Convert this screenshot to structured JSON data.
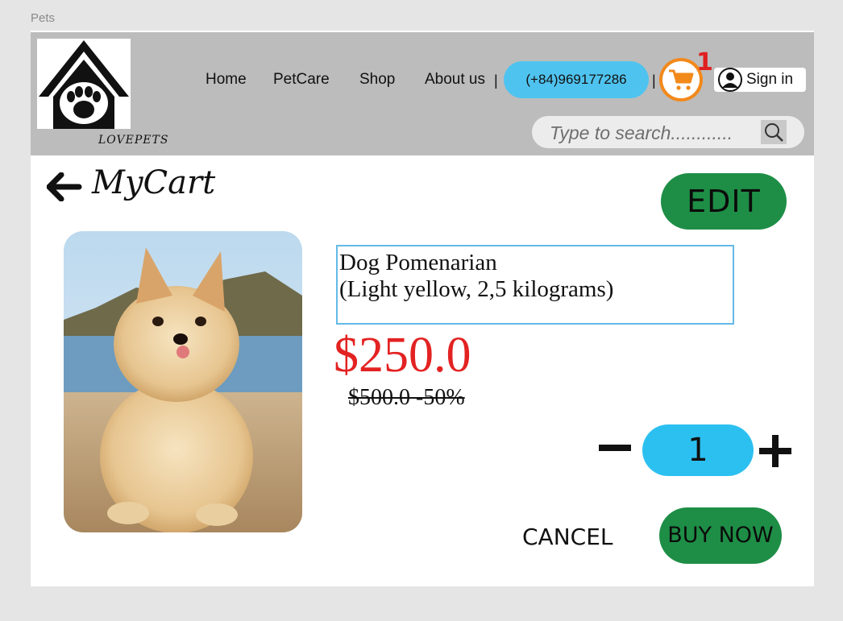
{
  "window": {
    "title": "Pets"
  },
  "header": {
    "logo_text": "LOVEPETS",
    "nav": [
      {
        "label": "Home"
      },
      {
        "label": "PetCare"
      },
      {
        "label": "Shop"
      },
      {
        "label": "About us"
      }
    ],
    "separator": "|",
    "phone": "(+84)969177286",
    "cart_count": "1",
    "sign_in": "Sign in",
    "search_placeholder": "Type to search............"
  },
  "page": {
    "title": "MyCart",
    "edit_label": "EDIT"
  },
  "product": {
    "name_line1": "Dog Pomenarian",
    "name_line2": "(Light yellow, 2,5 kilograms)",
    "price": "$250.0",
    "old_price": "$500.0 -50%",
    "quantity": "1"
  },
  "actions": {
    "cancel": "CANCEL",
    "buy_now": "BUY NOW"
  },
  "colors": {
    "accent_blue": "#4fc3ef",
    "green_button": "#1e8e46",
    "price_red": "#e32222",
    "cart_orange": "#f2891b"
  }
}
